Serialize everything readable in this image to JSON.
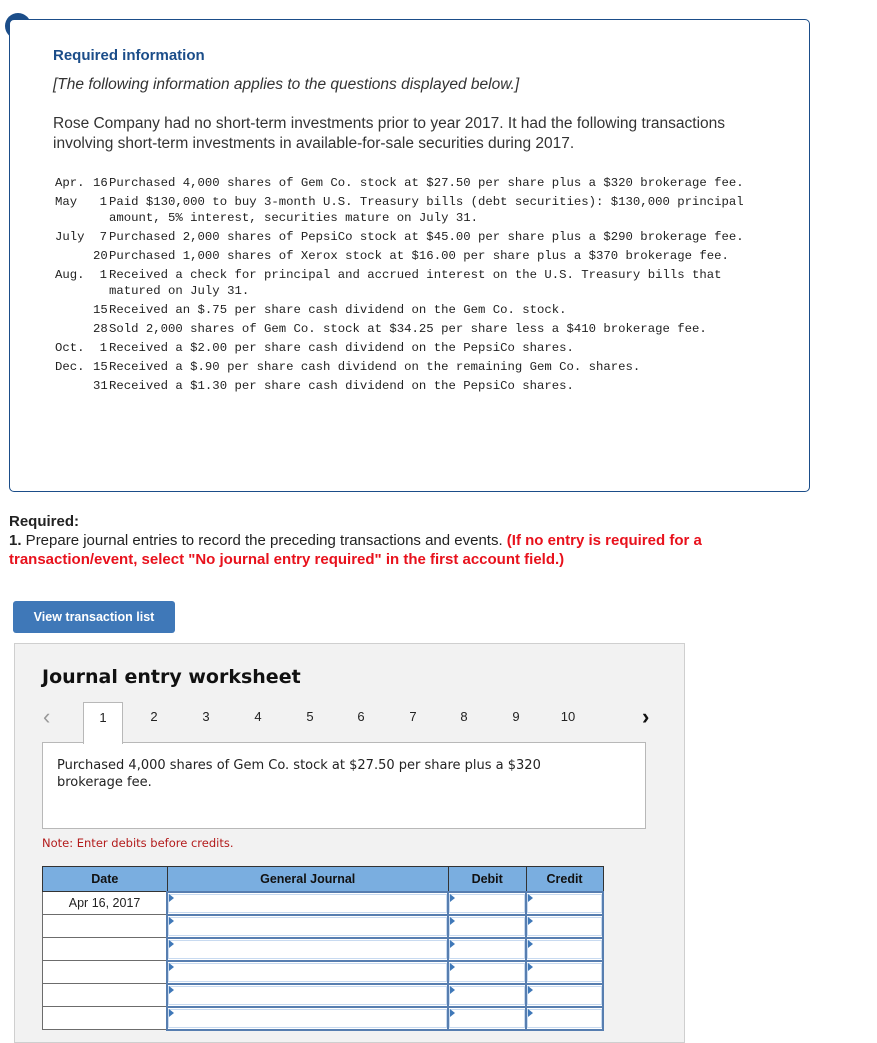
{
  "alert": {
    "icon": "!"
  },
  "info": {
    "title": "Required information",
    "subtitle": "[The following information applies to the questions displayed below.]",
    "paragraph": "Rose Company had no short-term investments prior to year 2017. It had the following transactions involving short-term investments in available-for-sale securities during 2017.",
    "transactions": [
      {
        "month": "Apr.",
        "day": "16",
        "desc": "Purchased 4,000 shares of Gem Co. stock at $27.50 per share plus a $320 brokerage fee."
      },
      {
        "month": "May",
        "day": "1",
        "desc": "Paid $130,000 to buy 3-month U.S. Treasury bills (debt securities): $130,000 principal amount, 5% interest, securities mature on July 31."
      },
      {
        "month": "July",
        "day": "7",
        "desc": "Purchased 2,000 shares of PepsiCo stock at $45.00 per share plus a $290 brokerage fee."
      },
      {
        "month": "",
        "day": "20",
        "desc": "Purchased 1,000 shares of Xerox stock at $16.00 per share plus a $370 brokerage fee."
      },
      {
        "month": "Aug.",
        "day": "1",
        "desc": "Received a check for principal and accrued interest on the U.S. Treasury bills that matured on July 31."
      },
      {
        "month": "",
        "day": "15",
        "desc": "Received an $.75 per share cash dividend on the Gem Co. stock."
      },
      {
        "month": "",
        "day": "28",
        "desc": "Sold 2,000 shares of Gem Co. stock at $34.25 per share less a $410 brokerage fee."
      },
      {
        "month": "Oct.",
        "day": "1",
        "desc": "Received a $2.00 per share cash dividend on the PepsiCo shares."
      },
      {
        "month": "Dec.",
        "day": "15",
        "desc": "Received a $.90 per share cash dividend on the remaining Gem Co. shares."
      },
      {
        "month": "",
        "day": "31",
        "desc": "Received a $1.30 per share cash dividend on the PepsiCo shares."
      }
    ]
  },
  "required": {
    "heading": "Required:",
    "number": "1.",
    "text": " Prepare journal entries to record the preceding transactions and events. ",
    "instruction": "(If no entry is required for a transaction/event, select \"No journal entry required\" in the first account field.)"
  },
  "view_button": {
    "label": "View transaction list"
  },
  "worksheet": {
    "title": "Journal entry worksheet",
    "prev_icon": "‹",
    "next_icon": "›",
    "tabs": [
      "1",
      "2",
      "3",
      "4",
      "5",
      "6",
      "7",
      "8",
      "9",
      "10"
    ],
    "active_tab": "1",
    "description": "Purchased 4,000 shares of Gem Co. stock at $27.50 per share plus a $320 brokerage fee.",
    "note": "Note: Enter debits before credits.",
    "table": {
      "headers": {
        "date": "Date",
        "general_journal": "General Journal",
        "debit": "Debit",
        "credit": "Credit"
      },
      "rows": [
        {
          "date": "Apr 16, 2017",
          "account": "",
          "debit": "",
          "credit": ""
        },
        {
          "date": "",
          "account": "",
          "debit": "",
          "credit": ""
        },
        {
          "date": "",
          "account": "",
          "debit": "",
          "credit": ""
        },
        {
          "date": "",
          "account": "",
          "debit": "",
          "credit": ""
        },
        {
          "date": "",
          "account": "",
          "debit": "",
          "credit": ""
        },
        {
          "date": "",
          "account": "",
          "debit": "",
          "credit": ""
        }
      ]
    }
  }
}
